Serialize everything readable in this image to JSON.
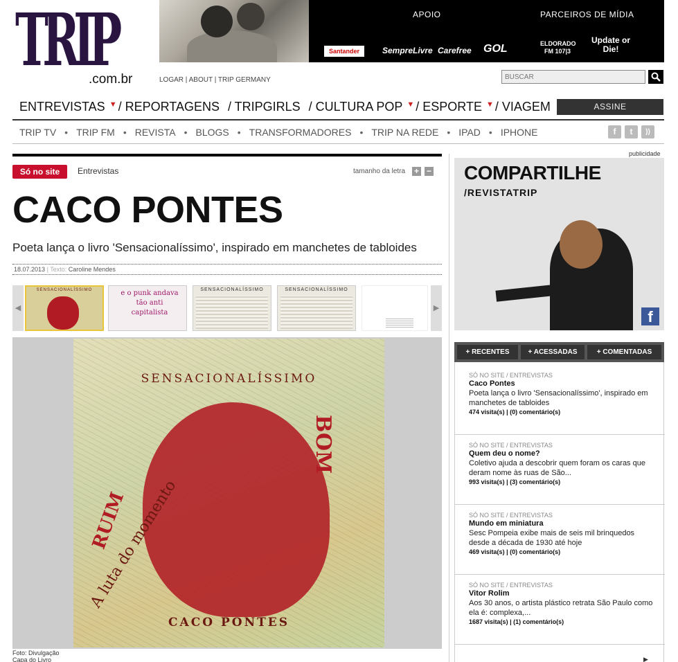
{
  "logo": {
    "mark": "TRIP",
    "domain": ".com.br"
  },
  "sponsors": {
    "apoio_label": "APOIO",
    "parceiros_label": "PARCEIROS DE MÍDIA",
    "brands": [
      "Santander",
      "SempreLivre",
      "Carefree",
      "GOL",
      "ELDORADO FM 107|3",
      "Update or Die!"
    ]
  },
  "top_links": {
    "logar": "LOGAR",
    "about": "ABOUT",
    "germany": "TRIP GERMANY"
  },
  "search": {
    "placeholder": "BUSCAR"
  },
  "main_nav": [
    {
      "label": "ENTREVISTAS",
      "dropdown": true
    },
    {
      "label": "/ REPORTAGENS",
      "dropdown": false
    },
    {
      "label": "/ TRIPGIRLS",
      "dropdown": false
    },
    {
      "label": "/ CULTURA POP",
      "dropdown": true
    },
    {
      "label": "/ ESPORTE",
      "dropdown": true
    },
    {
      "label": "/ VIAGEM",
      "dropdown": false
    }
  ],
  "assine": "ASSINE",
  "sub_nav": [
    "TRIP TV",
    "TRIP FM",
    "REVISTA",
    "BLOGS",
    "TRANSFORMADORES",
    "TRIP NA REDE",
    "IPAD",
    "IPHONE"
  ],
  "social_icons": [
    "facebook-icon",
    "twitter-icon",
    "rss-icon"
  ],
  "article": {
    "badge": "Só no site",
    "section": "Entrevistas",
    "font_size_label": "tamanho da letra",
    "title": "CACO PONTES",
    "subtitle": "Poeta lança o livro 'Sensacionalíssimo', inspirado em manchetes de tabloides",
    "date": "18.07.2013",
    "author_label": "Texto:",
    "author": "Caroline Mendes",
    "thumbs": [
      {
        "text": "SENSACIONALÍSSIMO"
      },
      {
        "text": "e o punk andava tão anti capitalista"
      },
      {
        "text": "SENSACIONALÍSSIMO"
      },
      {
        "text": "SENSACIONALÍSSIMO"
      },
      {
        "text": ""
      }
    ],
    "cover": {
      "title": "SENSACIONALÍSSIMO",
      "bom": "BOM",
      "ruim": "RUIM",
      "luta": "A luta do momento",
      "name": "CACO PONTES"
    },
    "photo_credit": "Foto: Divulgação",
    "photo_caption": "Capa do Livro"
  },
  "sidebar": {
    "ad_label": "publicidade",
    "ad_headline": "COMPARTILHE",
    "ad_handle": "/REVISTATRIP",
    "tabs": [
      "+ RECENTES",
      "+ ACESSADAS",
      "+ COMENTADAS"
    ],
    "items": [
      {
        "category": "SÓ NO SITE / ENTREVISTAS",
        "title": "Caco Pontes",
        "desc": "Poeta lança o livro 'Sensacionalíssimo', inspirado em manchetes de tabloides",
        "visits": "474",
        "comments": "(0)"
      },
      {
        "category": "SÓ NO SITE / ENTREVISTAS",
        "title": "Quem deu o nome?",
        "desc": "Coletivo ajuda a descobrir quem foram os caras que deram nome às ruas de São...",
        "visits": "993",
        "comments": "(3)"
      },
      {
        "category": "SÓ NO SITE / ENTREVISTAS",
        "title": "Mundo em miniatura",
        "desc": "Sesc Pompeia exibe mais de seis mil brinquedos desde a década de 1930 até hoje",
        "visits": "469",
        "comments": "(0)"
      },
      {
        "category": "SÓ NO SITE / ENTREVISTAS",
        "title": "Vitor Rolim",
        "desc": "Aos 30 anos, o artista plástico retrata São Paulo como ela é: complexa,...",
        "visits": "1687",
        "comments": "(1)"
      }
    ],
    "visits_suffix": "visita(s)",
    "comments_suffix": "comentário(s)"
  },
  "colors": {
    "accent_red": "#c8102e",
    "facebook_blue": "#3b5998",
    "nav_arrow": "#cc2222"
  }
}
